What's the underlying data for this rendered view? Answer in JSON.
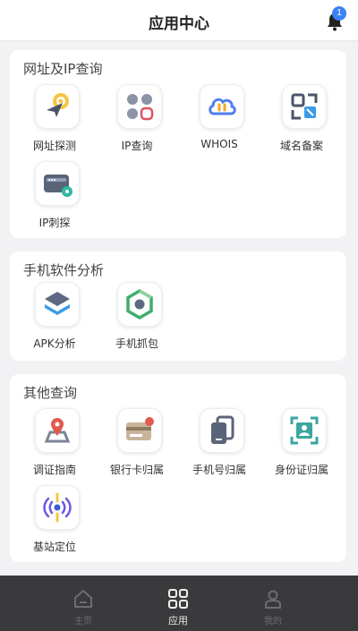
{
  "header": {
    "title": "应用中心",
    "notification_count": "1"
  },
  "sections": [
    {
      "title": "网址及IP查询",
      "items": [
        {
          "label": "网址探测",
          "icon": "target-cursor-icon"
        },
        {
          "label": "IP查询",
          "icon": "ip-grid-icon"
        },
        {
          "label": "WHOIS",
          "icon": "cloud-link-icon"
        },
        {
          "label": "域名备案",
          "icon": "domain-frame-icon"
        },
        {
          "label": "IP刺探",
          "icon": "server-pin-icon"
        }
      ]
    },
    {
      "title": "手机软件分析",
      "items": [
        {
          "label": "APK分析",
          "icon": "layers-icon"
        },
        {
          "label": "手机抓包",
          "icon": "hexagon-capture-icon"
        }
      ]
    },
    {
      "title": "其他查询",
      "items": [
        {
          "label": "调证指南",
          "icon": "map-pin-icon"
        },
        {
          "label": "银行卡归属",
          "icon": "bank-card-icon"
        },
        {
          "label": "手机号归属",
          "icon": "phone-copy-icon"
        },
        {
          "label": "身份证归属",
          "icon": "id-scan-icon"
        },
        {
          "label": "基站定位",
          "icon": "signal-tower-icon"
        }
      ]
    }
  ],
  "bottom_nav": [
    {
      "label": "主页",
      "icon": "home-icon",
      "active": false
    },
    {
      "label": "应用",
      "icon": "apps-grid-icon",
      "active": true
    },
    {
      "label": "我的",
      "icon": "user-icon",
      "active": false
    }
  ],
  "colors": {
    "accent_blue": "#3b82f6",
    "nav_bg": "#3a3a3c",
    "card_bg": "#ffffff",
    "page_bg": "#f2f2f4"
  }
}
